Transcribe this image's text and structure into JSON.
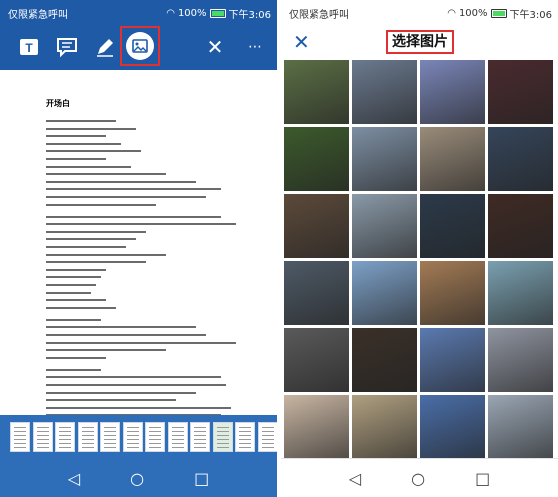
{
  "left_phone": {
    "status": {
      "carrier": "仅限紧急呼叫",
      "battery": "100%",
      "time": "下午3:06"
    },
    "toolbar": {
      "icons": [
        "text-icon",
        "comment-icon",
        "pen-icon",
        "image-icon",
        "close-icon",
        "more-icon"
      ]
    },
    "document": {
      "title": "开场白"
    },
    "thumbnail_count": 12
  },
  "right_phone": {
    "status": {
      "carrier": "仅限紧急呼叫",
      "battery": "100%",
      "time": "下午3:06"
    },
    "header": {
      "title": "选择图片"
    },
    "photos": [
      "#5b6f45",
      "#6b7a8f",
      "#7a86b8",
      "#4a2a2e",
      "#3c5a2c",
      "#7d8fa3",
      "#9a8c7a",
      "#35455a",
      "#5c4a3a",
      "#8a9aa8",
      "#2b3a4a",
      "#3f2a24",
      "#4e5a66",
      "#7da1c8",
      "#a37b55",
      "#7aa0b0",
      "#5a5a5a",
      "#3a3028",
      "#5a7ab0",
      "#8f94a0",
      "#c9b6a3",
      "#b0a080",
      "#4a6ea8",
      "#9aa6b4"
    ]
  },
  "colors": {
    "brand_blue": "#1f5aa6",
    "thumb_bar": "#2e6db8",
    "highlight": "#e03030"
  }
}
